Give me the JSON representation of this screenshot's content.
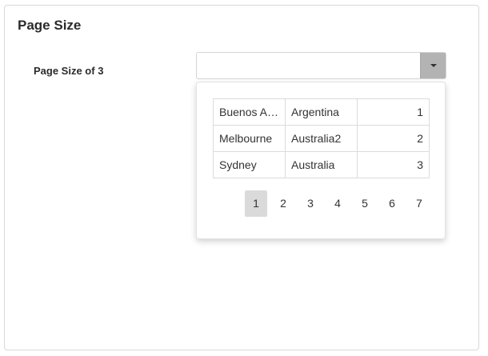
{
  "panel": {
    "title": "Page Size"
  },
  "field": {
    "label": "Page Size of 3",
    "value": ""
  },
  "dropdown": {
    "rows": [
      {
        "city": "Buenos A…",
        "country": "Argentina",
        "id": "1"
      },
      {
        "city": "Melbourne",
        "country": "Australia2",
        "id": "2"
      },
      {
        "city": "Sydney",
        "country": "Australia",
        "id": "3"
      }
    ],
    "pager": {
      "pages": [
        "1",
        "2",
        "3",
        "4",
        "5",
        "6",
        "7"
      ],
      "current": "1"
    }
  },
  "icons": {
    "dropdown_button": "chevron-down-icon"
  }
}
